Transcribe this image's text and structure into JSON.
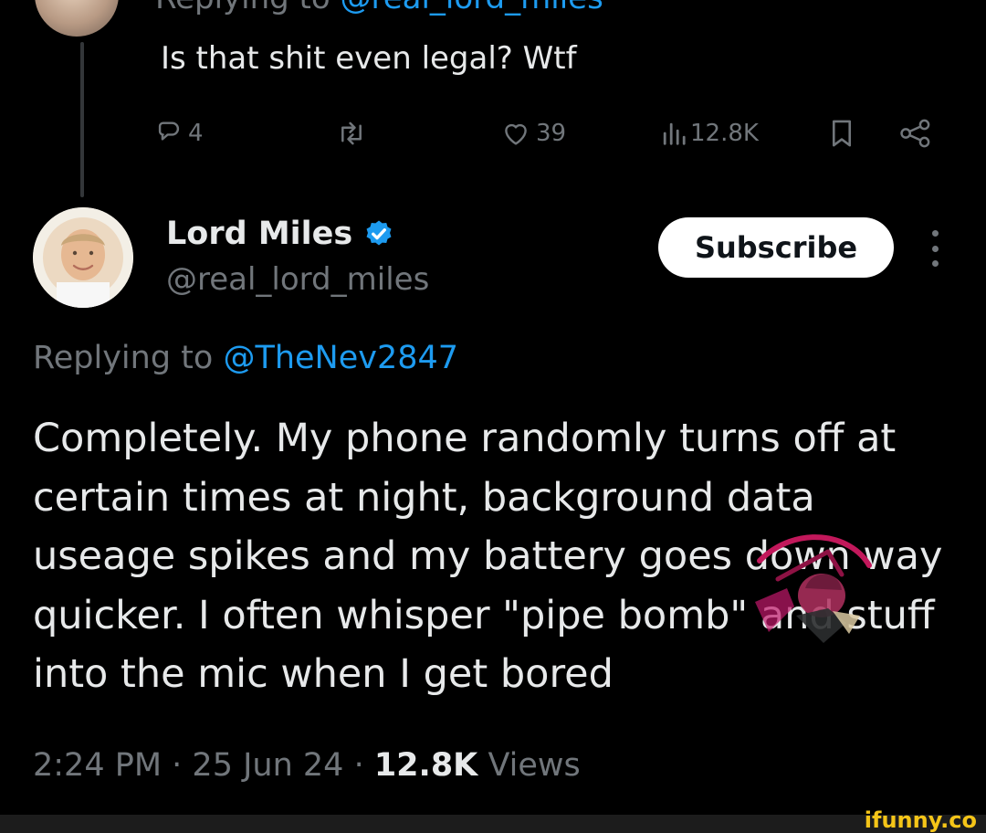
{
  "parent_tweet": {
    "replying_prefix": "Replying to ",
    "replying_handle": "@real_lord_miles",
    "text": "Is that shit even legal? Wtf",
    "stats": {
      "replies": "4",
      "likes": "39",
      "views": "12.8K"
    }
  },
  "tweet": {
    "display_name": "Lord Miles",
    "username": "@real_lord_miles",
    "subscribe_label": "Subscribe",
    "replying_prefix": "Replying to ",
    "replying_handle": "@TheNev2847",
    "body": "Completely. My phone randomly turns off at certain times at night, background data useage spikes and my battery goes down way quicker. I often whisper \"pipe bomb\" and stuff into the mic when I get bored",
    "meta": {
      "time": "2:24 PM",
      "date": "25 Jun 24",
      "views_count": "12.8K",
      "views_label": "Views"
    }
  },
  "watermark": "ifunny.co",
  "colors": {
    "background": "#000000",
    "text_primary": "#e7e9ea",
    "text_secondary": "#71767b",
    "link": "#1d9bf0",
    "verified": "#1d9bf0"
  },
  "icons": [
    "reply-icon",
    "retweet-icon",
    "like-icon",
    "views-icon",
    "bookmark-icon",
    "share-icon",
    "verified-badge-icon",
    "more-options-icon"
  ]
}
